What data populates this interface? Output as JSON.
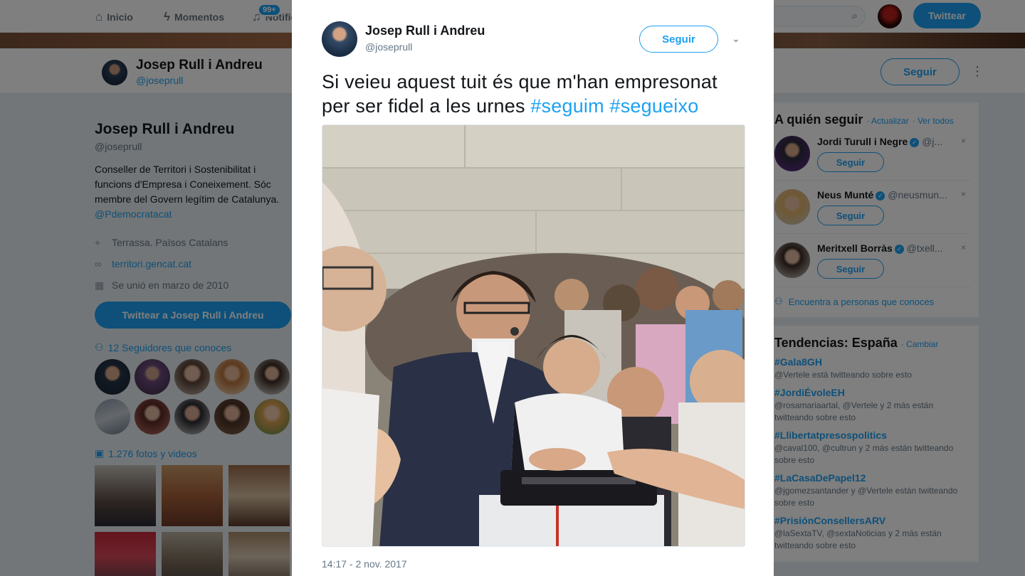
{
  "nav": {
    "home": "Inicio",
    "moments": "Momentos",
    "notifications": "Notificaciones",
    "notif_badge": "99+",
    "search_placeholder": "r",
    "tweet": "Twittear"
  },
  "profile": {
    "name": "Josep Rull i Andreu",
    "handle": "@joseprull",
    "follow": "Seguir",
    "bio": "Conseller de Territori i Sostenibilitat i funcions d'Empresa i Coneixement. Sóc membre del Govern legítim de Catalunya.",
    "bio_link": "@Pdemocratacat",
    "location": "Terrassa. Països Catalans",
    "website": "territori.gencat.cat",
    "joined": "Se unió en marzo de 2010",
    "tweet_to": "Twittear a Josep Rull i Andreu",
    "followers_you_know": "12 Seguidores que conoces",
    "photos": "1.276 fotos y videos"
  },
  "who_to_follow": {
    "title": "A quién seguir",
    "refresh": "· Actualizar",
    "view_all": "· Ver todos",
    "items": [
      {
        "name": "Jordi Turull i Negre",
        "handle": "@j...",
        "follow": "Seguir",
        "dismiss": "×"
      },
      {
        "name": "Neus Munté",
        "handle": "@neusmun...",
        "follow": "Seguir",
        "dismiss": "×"
      },
      {
        "name": "Meritxell Borràs",
        "handle": "@txell...",
        "follow": "Seguir",
        "dismiss": "×"
      }
    ],
    "find_people": "Encuentra a personas que conoces"
  },
  "trends": {
    "title": "Tendencias: España",
    "change": "· Cambiar",
    "items": [
      {
        "tag": "#Gala8GH",
        "desc": "@Vertele está twitteando sobre esto"
      },
      {
        "tag": "#JordiÉvoleEH",
        "desc": "@rosamariaartal, @Vertele y 2 más están twitteando sobre esto"
      },
      {
        "tag": "#Llibertatpresospolitics",
        "desc": "@caval100, @cultrun y 2 más están twitteando sobre esto"
      },
      {
        "tag": "#LaCasaDePapel12",
        "desc": "@jgomezsantander y @Vertele están twitteando sobre esto"
      },
      {
        "tag": "#PrisiónConsellersARV",
        "desc": "@laSextaTV, @sextaNoticias y 2 más están twitteando sobre esto"
      }
    ]
  },
  "tweet": {
    "name": "Josep Rull i Andreu",
    "handle": "@joseprull",
    "follow": "Seguir",
    "text": "Si veieu aquest tuit és que m'han empresonat per ser fidel a les urnes ",
    "hashtag1": "#seguim",
    "hashtag2": "#segueixo",
    "timestamp": "14:17 - 2 nov. 2017"
  },
  "colors": {
    "accent": "#1da1f2",
    "text": "#14171a",
    "muted": "#657786"
  }
}
